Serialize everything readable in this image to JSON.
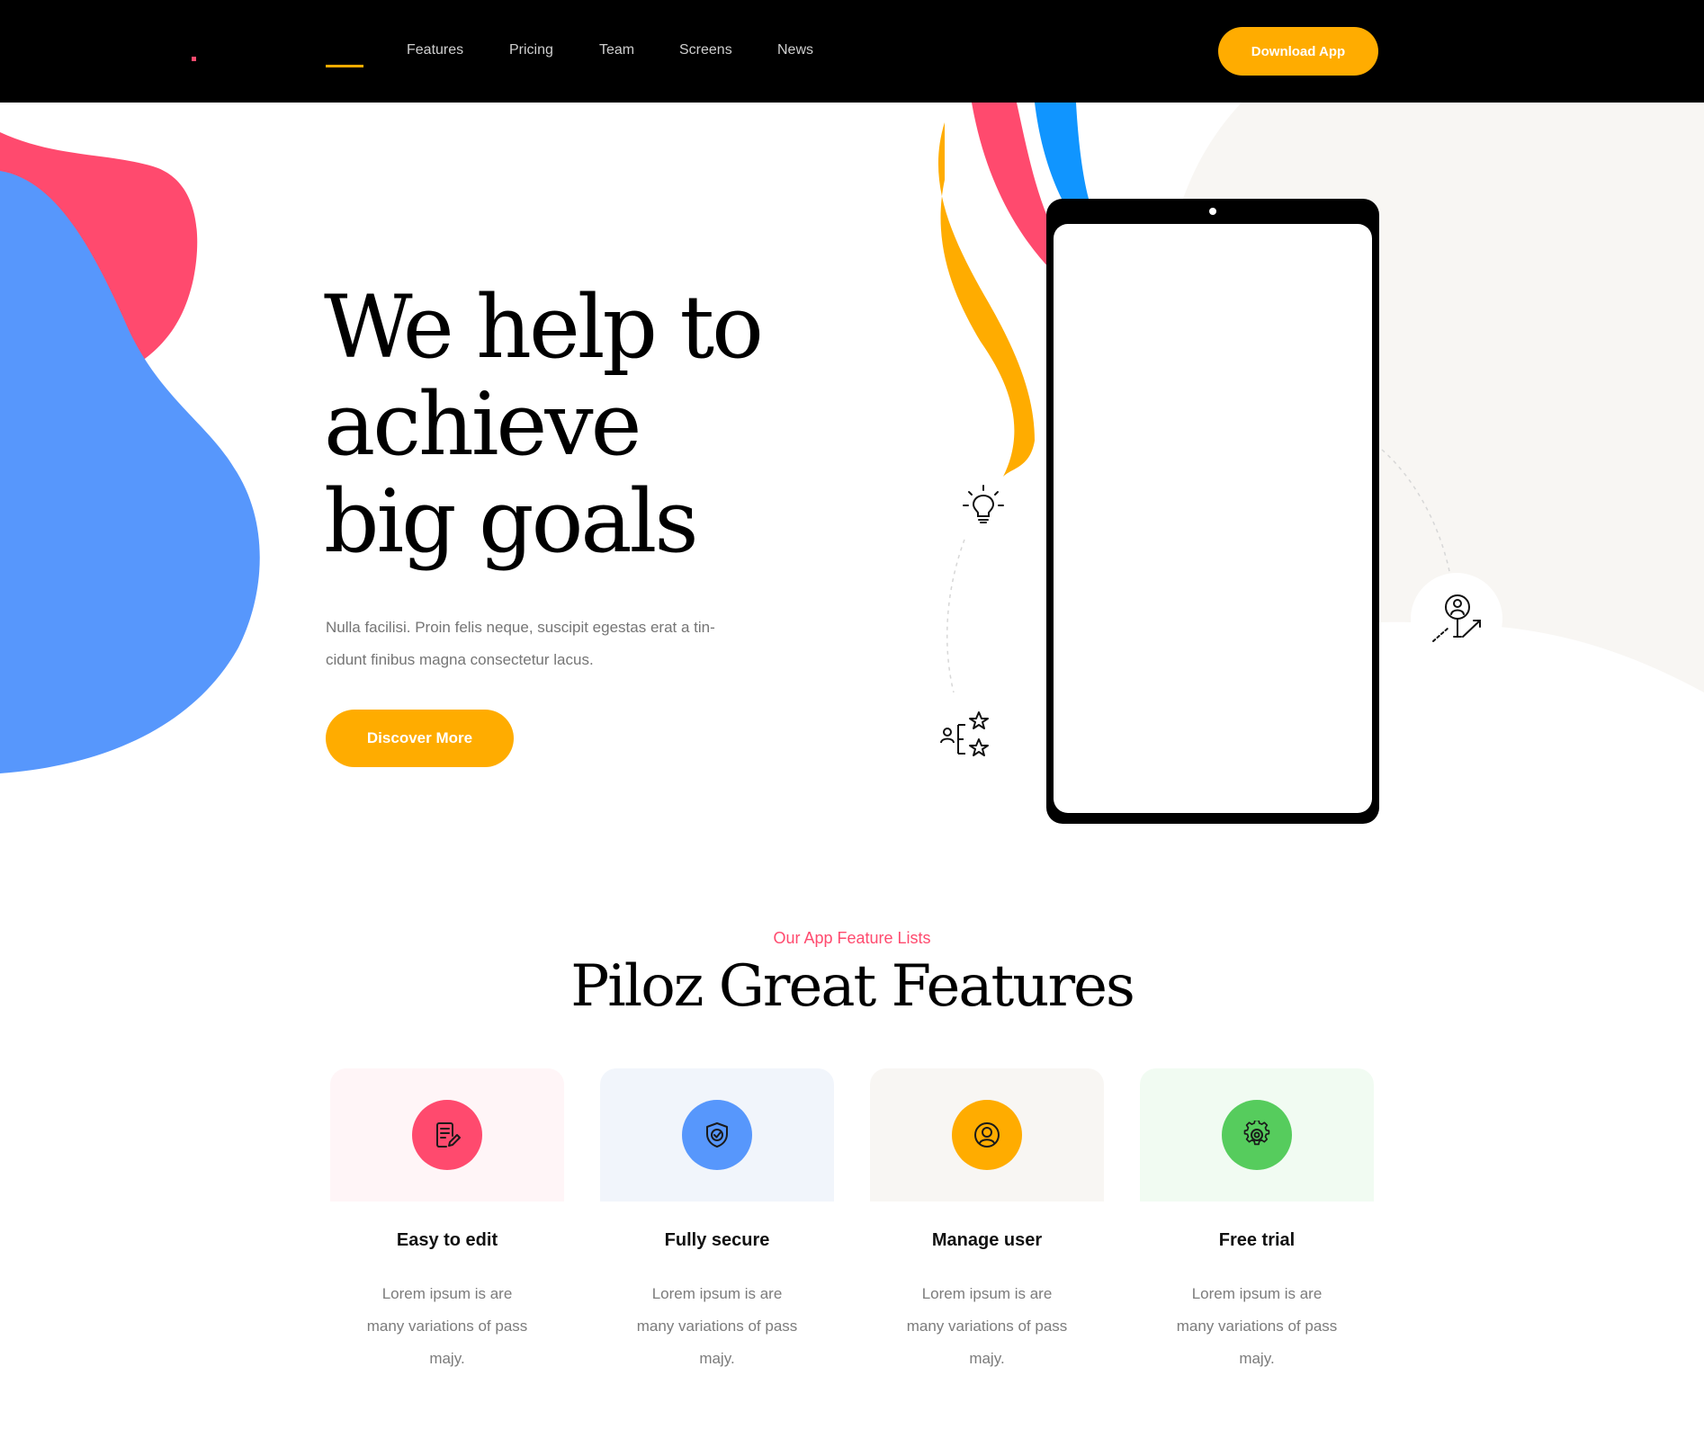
{
  "nav": {
    "links": [
      {
        "label": "Features"
      },
      {
        "label": "Pricing"
      },
      {
        "label": "Team"
      },
      {
        "label": "Screens"
      },
      {
        "label": "News"
      }
    ],
    "cta_label": "Download App"
  },
  "hero": {
    "title": "We help to achieve big goals",
    "description": "Nulla facilisi. Proin felis neque, suscipit egestas erat a tin-cidunt finibus magna consectetur lacus.",
    "cta_label": "Discover More",
    "icons": [
      "lightbulb-icon",
      "stars-rating-icon",
      "user-growth-icon"
    ]
  },
  "features": {
    "subtitle": "Our App Feature Lists",
    "title": "Piloz Great Features",
    "cards": [
      {
        "title": "Easy to edit",
        "description": "Lorem ipsum is are many variations of pass majy.",
        "icon": "edit-document-icon",
        "accent": "#ff4a6e",
        "bg": "#fff5f7"
      },
      {
        "title": "Fully secure",
        "description": "Lorem ipsum is are many variations of pass majy.",
        "icon": "shield-check-icon",
        "accent": "#5797fc",
        "bg": "#f1f5fb"
      },
      {
        "title": "Manage user",
        "description": "Lorem ipsum is are many variations of pass majy.",
        "icon": "user-circle-icon",
        "accent": "#ffac00",
        "bg": "#f8f6f3"
      },
      {
        "title": "Free trial",
        "description": "Lorem ipsum is are many variations of pass majy.",
        "icon": "gear-icon",
        "accent": "#56cc5d",
        "bg": "#f1fbf2"
      }
    ]
  },
  "colors": {
    "primary": "#ffac00",
    "pink": "#ff4a6e",
    "blue": "#5797fc",
    "green": "#56cc5d",
    "nav_bg": "#000000"
  }
}
